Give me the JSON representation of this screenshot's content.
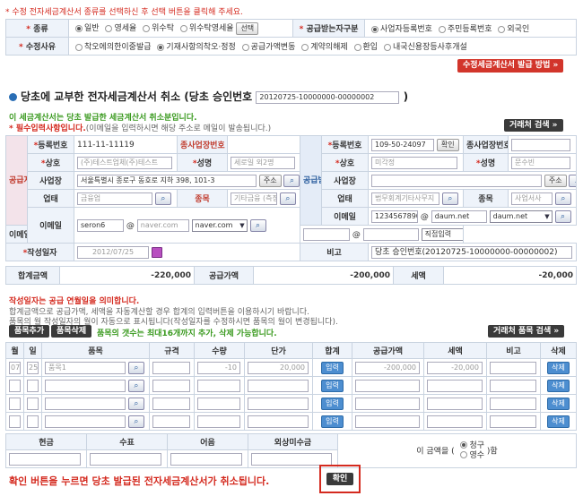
{
  "notice": "* 수정 전자세금계산서 종류를 선택하신 후 선택 버튼을 클릭해 주세요.",
  "type_row": {
    "label": "종류",
    "options": [
      "일반",
      "영세율",
      "위수탁",
      "위수탁영세율"
    ],
    "select_button": "선택",
    "receiver_label": "공급받는자구분",
    "receiver_options": [
      "사업자등록번호",
      "주민등록번호",
      "외국인"
    ]
  },
  "reason_row": {
    "label": "수정사유",
    "options": [
      "착오에의한이중발급",
      "기재사항의착오·정정",
      "공급가액변동",
      "계약의해제",
      "환입",
      "내국신용장등사후개설"
    ]
  },
  "method_button": "수정세금계산서 발급 방법",
  "title": {
    "main": "당초에 교부한 전자세금계산서 취소 (당초 승인번호",
    "approval_no": "20120725-10000000-00000002",
    "close": ")"
  },
  "info_line": "이 세금계산서는 당초 발급한 세금계산서 취소분입니다.",
  "required_line": "* 필수입력사항입니다.",
  "required_sub": "(이메일을 입력하시면 해당 주소로 메일이 발송됩니다.)",
  "client_search_button": "거래처 검색",
  "supplier": {
    "side_label": "공급자",
    "reg_label": "등록번호",
    "reg_value": "111-11-11119",
    "branch_label": "종사업장번호",
    "name_label": "상호",
    "name_value": "(주)테스트업체(주)테스트",
    "rep_label": "성명",
    "rep_value": "세로일 외2명",
    "addr_label": "사업장",
    "addr_value": "서울특별시 종로구 동호로 지하 398, 101-3",
    "addr_button": "주소",
    "biz_label": "업태",
    "biz_value": "금융업",
    "item_label": "종목",
    "item_value": "기타금융 (측정)",
    "email_label": "이메일",
    "email_id": "seron6",
    "email_domain": "naver.com",
    "email_select": "naver.com"
  },
  "receiver": {
    "side_label": "공급받는자",
    "reg_label": "등록번호",
    "reg_value": "109-50-24097",
    "confirm_button": "확인",
    "branch_label": "종사업장번호",
    "name_label": "상호",
    "name_value": "미각정",
    "rep_label": "성명",
    "rep_value": "문수빈",
    "addr_label": "사업장",
    "addr_button": "주소",
    "biz_label": "업태",
    "biz_value": "법무회계기타사무지",
    "item_label": "종목",
    "item_value": "사업서사",
    "email_label": "이메일",
    "email_id": "1234567890",
    "email_domain": "daum.net",
    "email_select": "daum.net",
    "email2_label": "이메일",
    "email2_select": "직접입력"
  },
  "write_date": {
    "label": "작성일자",
    "value": "2012/07/25"
  },
  "memo": {
    "label": "비고",
    "value": "당초 승인번호(20120725-10000000-00000002)"
  },
  "totals": {
    "total_label": "합계금액",
    "total_value": "-220,000",
    "supply_label": "공급가액",
    "supply_value": "-200,000",
    "tax_label": "세액",
    "tax_value": "-20,000"
  },
  "date_note": {
    "title": "작성일자는 공급 연월일을 의미합니다.",
    "line1": "합계금액으로 공급가액, 세액을 자동계산할 경우 합계의 입력버튼을 이용하시기 바랍니다.",
    "line2": "품목의 월 작성일자의 월이 자동으로 표시됩니다(작성일자를 수정하시면 품목의 월이 변경됩니다)."
  },
  "item_toolbar": {
    "add": "품목추가",
    "remove": "품목삭제",
    "limit": "품목의 갯수는 최대16개까지 추가, 삭제 가능합니다.",
    "search": "거래처 품목 검색"
  },
  "item_headers": [
    "월",
    "일",
    "품목",
    "규격",
    "수량",
    "단가",
    "합계",
    "공급가액",
    "세액",
    "비고",
    "삭제"
  ],
  "items": [
    {
      "month": "07",
      "day": "25",
      "name": "품목1",
      "qty": "-10",
      "price": "20,000",
      "supply": "-200,000",
      "tax": "-20,000"
    },
    {
      "month": "",
      "day": "",
      "name": "",
      "qty": "",
      "price": "",
      "supply": "",
      "tax": ""
    },
    {
      "month": "",
      "day": "",
      "name": "",
      "qty": "",
      "price": "",
      "supply": "",
      "tax": ""
    },
    {
      "month": "",
      "day": "",
      "name": "",
      "qty": "",
      "price": "",
      "supply": "",
      "tax": ""
    }
  ],
  "item_input_button": "입력",
  "item_delete_button": "삭제",
  "payment": {
    "headers": [
      "현금",
      "수표",
      "어음",
      "외상미수금"
    ],
    "amount_prefix": "이 금액을",
    "options": [
      "청구",
      "영수"
    ],
    "suffix": ")함"
  },
  "bottom_message": "확인 버튼을 누르면 당초 발급된 전자세금계산서가 취소됩니다.",
  "confirm_button": "확인"
}
